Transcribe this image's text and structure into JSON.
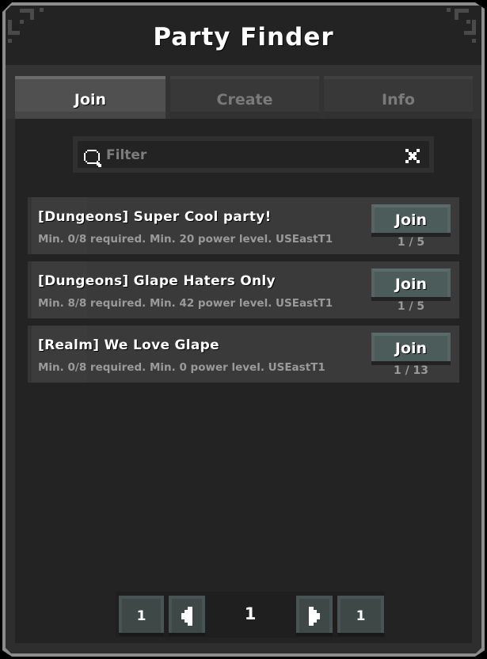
{
  "window": {
    "title": "Party Finder"
  },
  "tabs": [
    {
      "label": "Join",
      "active": true
    },
    {
      "label": "Create",
      "active": false
    },
    {
      "label": "Info",
      "active": false
    }
  ],
  "filter": {
    "placeholder": "Filter",
    "value": "",
    "search_icon": "magnifier-icon",
    "clear_icon": "x-icon"
  },
  "parties": [
    {
      "title": "[Dungeons] Super Cool party!",
      "description": "Min. 0/8 required. Min. 20 power level. USEastT1",
      "join_label": "Join",
      "count": "1 / 5"
    },
    {
      "title": "[Dungeons] Glape Haters Only",
      "description": "Min. 8/8 required. Min. 42 power level. USEastT1",
      "join_label": "Join",
      "count": "1 / 5"
    },
    {
      "title": "[Realm] We Love Glape",
      "description": "Min. 0/8 required. Min. 0 power level. USEastT1",
      "join_label": "Join",
      "count": "1 / 13"
    }
  ],
  "pagination": {
    "first_label": "1",
    "prev_icon": "arrow-left-icon",
    "current_page": "1",
    "next_icon": "arrow-right-icon",
    "last_label": "1"
  },
  "colors": {
    "panel_border": "#8c8c8c",
    "panel_bg": "#2e2e2e",
    "content_bg": "#242323",
    "button_bg": "#4c5c5b",
    "pager_button_bg": "#3d4847",
    "text_primary": "#ffffff",
    "text_muted": "#9a9a9a"
  }
}
